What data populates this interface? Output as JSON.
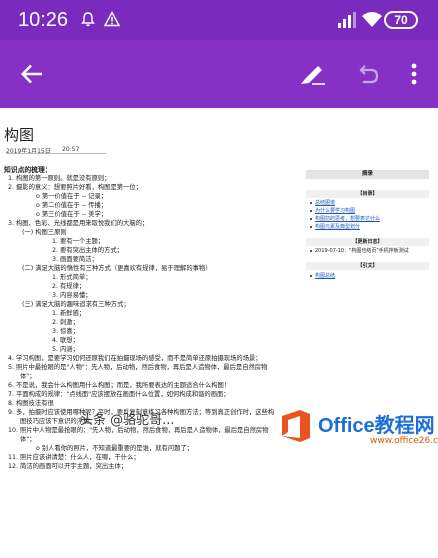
{
  "status_bar": {
    "time": "10:26",
    "battery": "70"
  },
  "note": {
    "title": "构图",
    "date": "2019年1月15日",
    "time": "20:57"
  },
  "body_lines": [
    {
      "text": "知识点的梳理：",
      "indent": 0,
      "bold": true
    },
    {
      "text": "1.   构图的第一原则。就是没有原则；",
      "indent": 1
    },
    {
      "text": "2.   摄影的意义：想要照片好看，构图是第一位；",
      "indent": 1
    },
    {
      "text": "o   第一价值在于 -- 记录；",
      "indent": 3
    },
    {
      "text": "o   第二价值在于 -- 传播；",
      "indent": 3
    },
    {
      "text": "o   第三价值在于 -- 美学；",
      "indent": 3
    },
    {
      "text": "3.   构图、色彩、光线都是用来取悦我们的大脑的；",
      "indent": 1
    },
    {
      "text": "(一)   构图三原则",
      "indent": 2
    },
    {
      "text": "1.   要有一个主题；",
      "indent": 4
    },
    {
      "text": "2.   要有突出主体的方式；",
      "indent": 4
    },
    {
      "text": "3.   画面要简洁；",
      "indent": 4
    },
    {
      "text": "(二)   满足大脑的惰性有三种方式（更喜欢有规律，易于理解的事物）",
      "indent": 2
    },
    {
      "text": "1.   形式简单；",
      "indent": 4
    },
    {
      "text": "2.   有规律；",
      "indent": 4
    },
    {
      "text": "3.   内容易懂；",
      "indent": 4
    },
    {
      "text": "(三)   满足大脑的趣味追求有三种方式；",
      "indent": 2
    },
    {
      "text": "1.   新鲜感；",
      "indent": 4
    },
    {
      "text": "2.   刺激；",
      "indent": 4
    },
    {
      "text": "3.   惊喜；",
      "indent": 4
    },
    {
      "text": "4.   联想；",
      "indent": 4
    },
    {
      "text": "5.   内涵；",
      "indent": 4
    },
    {
      "text": "4.   学习构图，是要学习如何还原我们在拍摄现场的感受，而不是简单还原拍摄现场的场景；",
      "indent": 1
    },
    {
      "text": "5.   照片中最抢眼的是\"人物\"：先人物，后动物，然后食物，再后是人造物体，最后是自然房物",
      "indent": 1
    },
    {
      "text": "体\"；",
      "indent": 5
    },
    {
      "text": "6.   不是说，我会什么构图用什么构图；而是，我所要表达的主题适合什么构图！",
      "indent": 1
    },
    {
      "text": "7.   平面构成的规律：\"点线面\"应该摆放在画面什么位置，如何构成和谐的画面；",
      "indent": 1
    },
    {
      "text": "8.   构图技法有很",
      "indent": 1
    },
    {
      "text": "9.   多，拍摄时应该使用哪种呢？平时，要反复刻意练习各种构图方法；等到真正创作时，这些构",
      "indent": 1
    },
    {
      "text": "图技巧应该下意识的浮现；",
      "indent": 5
    },
    {
      "text": "10.   照片中人物是最抢眼的：\"先人物，后动物，然后食物，再后是人造物体，最后是自然房物",
      "indent": 1
    },
    {
      "text": "体\"；",
      "indent": 5
    },
    {
      "text": "o   别人看你的照片，不知道最重要的是谁，就有问题了；",
      "indent": 3
    },
    {
      "text": "11.   照片应该讲清楚：什么人，在哪，干什么；",
      "indent": 1
    },
    {
      "text": "12.   简洁的画面可以开宇主题，突出主体；",
      "indent": 1
    }
  ],
  "sidebar": {
    "header": "摘录",
    "sections": [
      {
        "title": "【目录】",
        "items": [
          {
            "text": "总结图谱",
            "link": true
          },
          {
            "text": "为什么要学习构图",
            "link": true
          },
          {
            "text": "构图前的思考，想要表达什么",
            "link": true
          },
          {
            "text": "构图元素及典型划分",
            "link": true
          }
        ]
      },
      {
        "title": "【更新日志】",
        "items": [
          {
            "text": "2019-07-10：\"构图也结页\"手机拌板测试",
            "link": false
          }
        ]
      },
      {
        "title": "【引文】",
        "items": [
          {
            "text": "构图总结",
            "link": true
          }
        ]
      }
    ]
  },
  "watermark": {
    "brand": "Office教程网",
    "url": "www.office26.com",
    "caption": "头条 @骆驼哥..."
  }
}
